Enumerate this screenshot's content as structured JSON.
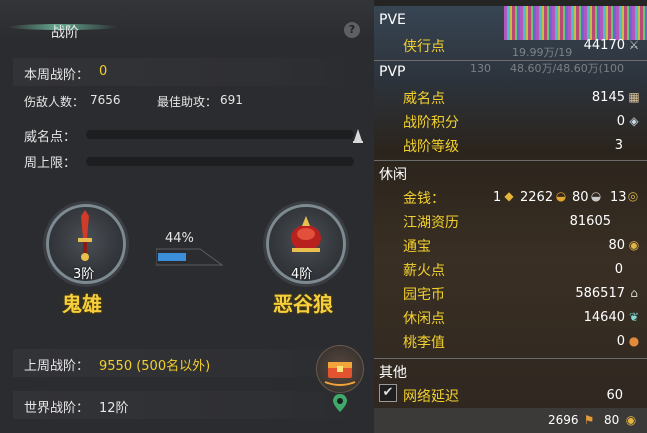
{
  "left_panel": {
    "title": "战阶",
    "help": "?",
    "weekly_rank_label": "本周战阶：",
    "weekly_rank_value": "0",
    "enemies_label": "伤敌人数：",
    "enemies_value": "7656",
    "best_assist_label": "最佳助攻：",
    "best_assist_value": "691",
    "prestige_label": "威名点：",
    "prestige_progress": 0,
    "weekly_cap_label": "周上限：",
    "weekly_cap_progress": 0,
    "current_tier": "3阶",
    "current_name": "鬼雄",
    "next_tier": "4阶",
    "next_name": "恶谷狼",
    "progress_percent": "44%",
    "progress_value": 0.44,
    "last_week_label": "上周战阶：",
    "last_week_value": "9550 (500名以外)",
    "world_rank_label": "世界战阶：",
    "world_rank_value": "12阶"
  },
  "right_panel": {
    "pve": {
      "header": "PVE",
      "items": [
        {
          "label": "侠行点",
          "value": "44170",
          "icon": "sword-icon"
        }
      ]
    },
    "pvp": {
      "header": "PVP",
      "items": [
        {
          "label": "威名点",
          "value": "8145",
          "icon": "scroll-icon"
        },
        {
          "label": "战阶积分",
          "value": "0",
          "icon": "crystal-icon"
        },
        {
          "label": "战阶等级",
          "value": "3"
        }
      ]
    },
    "leisure": {
      "header": "休闲",
      "money_label": "金钱：",
      "money_gold": "1",
      "money_silver": "2262",
      "money_copper": "80",
      "money_coin": "13",
      "items": [
        {
          "label": "江湖资历",
          "value": "81605"
        },
        {
          "label": "通宝",
          "value": "80",
          "icon": "coin-icon"
        },
        {
          "label": "薪火点",
          "value": "0"
        },
        {
          "label": "园宅币",
          "value": "586517",
          "icon": "house-coin-icon"
        },
        {
          "label": "休闲点",
          "value": "14640",
          "icon": "leaf-icon"
        },
        {
          "label": "桃李值",
          "value": "0",
          "icon": "gourd-icon"
        }
      ]
    },
    "other": {
      "header": "其他",
      "network_label": "网络延迟",
      "network_value": "60",
      "network_checked": true
    },
    "background_overlay": {
      "top_value": "19.99万/19",
      "level": "130",
      "hp": "48.60万/48.60万(100"
    },
    "bottom_bar": {
      "value_a": "2696",
      "value_b": "80"
    }
  }
}
